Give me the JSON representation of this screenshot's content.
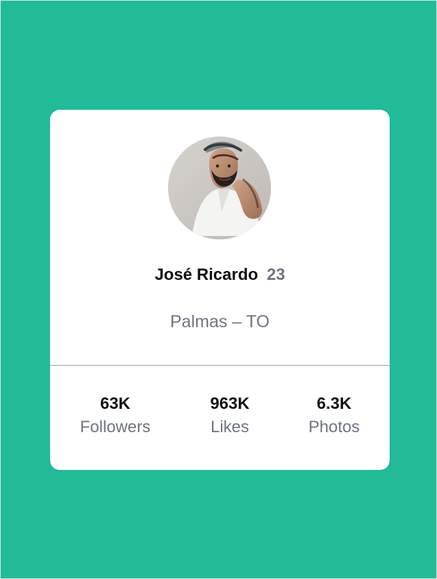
{
  "profile": {
    "name": "José Ricardo",
    "age": "23",
    "location": "Palmas – TO"
  },
  "stats": [
    {
      "value": "63K",
      "label": "Followers"
    },
    {
      "value": "963K",
      "label": "Likes"
    },
    {
      "value": "6.3K",
      "label": "Photos"
    }
  ],
  "colors": {
    "background": "#21bb98",
    "card": "#ffffff",
    "primary_text": "#111111",
    "secondary_text": "#6f7384",
    "divider": "#999ea8"
  }
}
